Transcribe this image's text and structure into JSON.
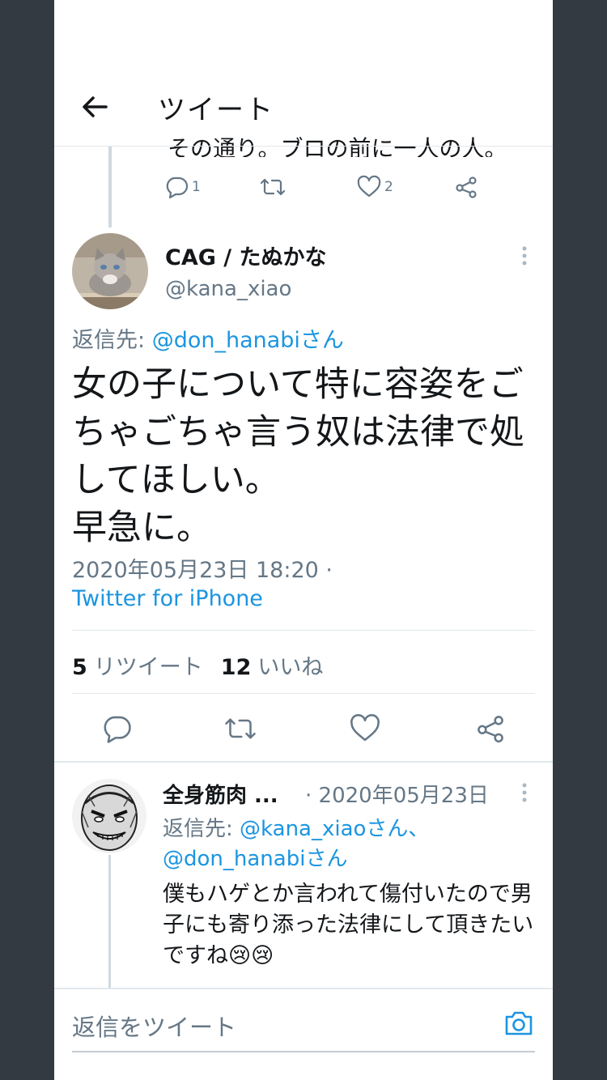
{
  "header": {
    "title": "ツイート"
  },
  "prev_tweet": {
    "cut_text": "その通り。ブロの前に一人の人。",
    "replies": "1",
    "retweets": "",
    "likes": "2"
  },
  "tweet": {
    "name": "CAG / たぬかな",
    "handle": "@kana_xiao",
    "reply_to_label": "返信先: ",
    "reply_to_user": "@don_hanabiさん",
    "lines": [
      "女の子について特に容姿をご",
      "ちゃごちゃ言う奴は法律で処",
      "してほしい。",
      "早急に。"
    ],
    "timestamp": "2020年05月23日 18:20 ·",
    "source": "Twitter for iPhone",
    "retweet_count": "5",
    "retweet_label": "リツイート",
    "like_count": "12",
    "like_label": "いいね"
  },
  "reply": {
    "name": "全身筋肉 ...",
    "date": "· 2020年05月23日",
    "reply_to_label": "返信先: ",
    "reply_to_user1": "@kana_xiaoさん、",
    "reply_to_user2": "@don_hanabiさん",
    "text": "僕もハゲとか言われて傷付いたので男子にも寄り添った法律にして頂きたいですね😢😢"
  },
  "compose": {
    "placeholder": "返信をツイート"
  },
  "colors": {
    "accent": "#1b95e0",
    "muted": "#657786",
    "text": "#14171a",
    "background_side": "#333a41"
  }
}
